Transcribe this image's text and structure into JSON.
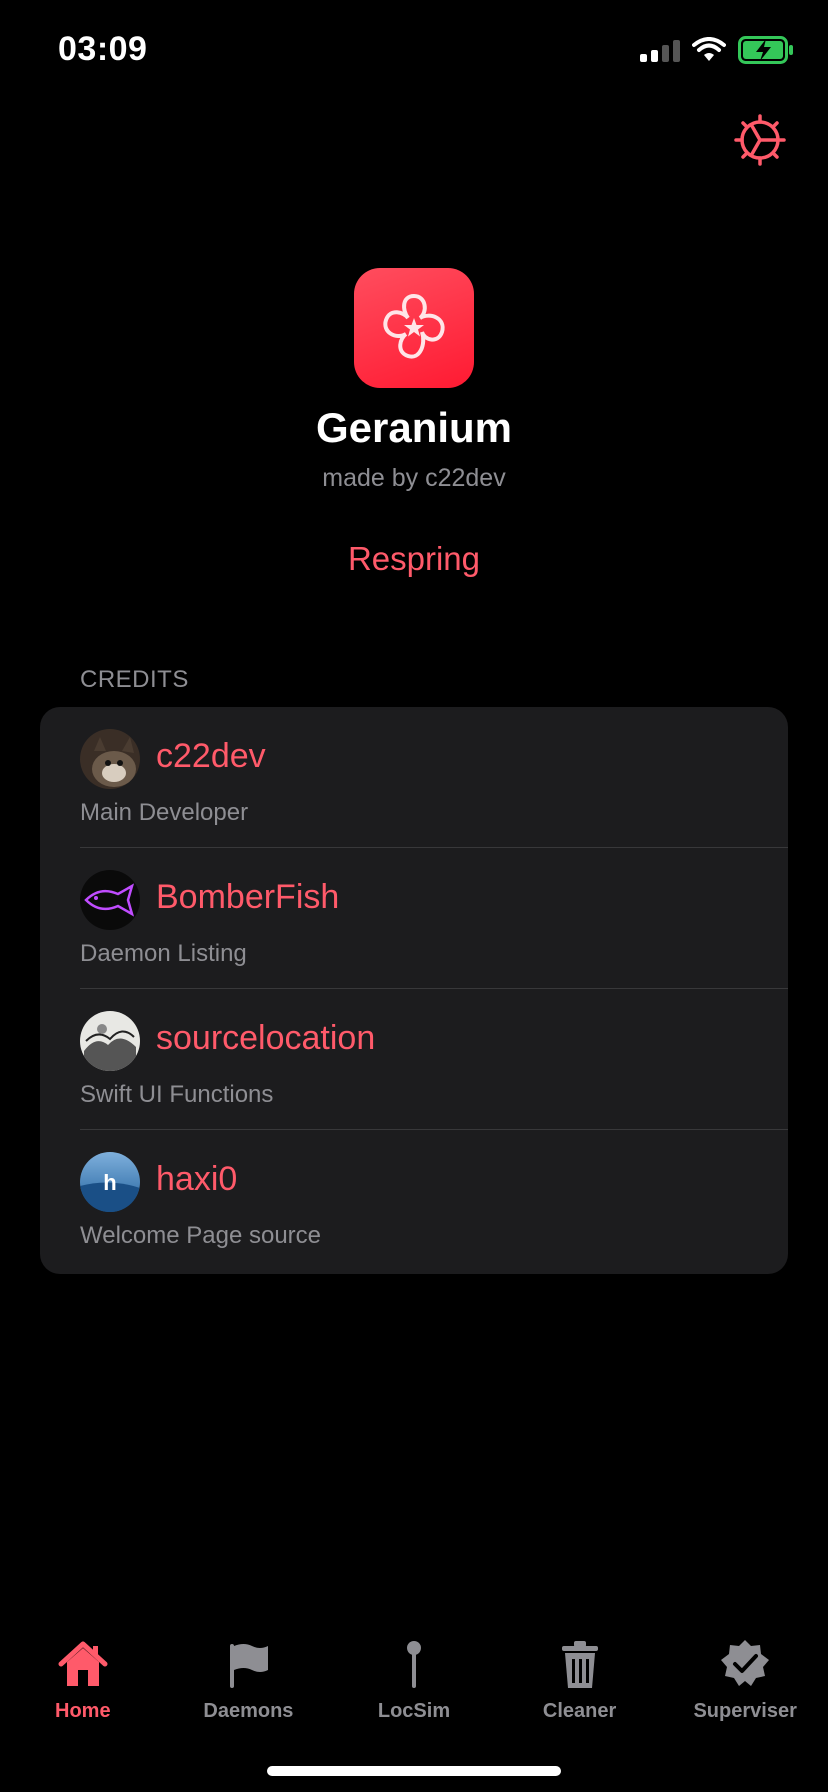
{
  "status_bar": {
    "time": "03:09"
  },
  "app": {
    "name": "Geranium",
    "subtitle": "made by c22dev",
    "respring_label": "Respring",
    "accent_color": "#ff5a6a"
  },
  "credits": {
    "header": "CREDITS",
    "items": [
      {
        "name": "c22dev",
        "role": "Main Developer"
      },
      {
        "name": "BomberFish",
        "role": "Daemon Listing"
      },
      {
        "name": "sourcelocation",
        "role": "Swift UI Functions"
      },
      {
        "name": "haxi0",
        "role": "Welcome Page source"
      }
    ]
  },
  "tab_bar": {
    "tabs": [
      {
        "label": "Home",
        "icon": "house-icon",
        "active": true
      },
      {
        "label": "Daemons",
        "icon": "flag-icon",
        "active": false
      },
      {
        "label": "LocSim",
        "icon": "pin-icon",
        "active": false
      },
      {
        "label": "Cleaner",
        "icon": "trash-icon",
        "active": false
      },
      {
        "label": "Superviser",
        "icon": "checkmark-seal-icon",
        "active": false
      }
    ]
  }
}
